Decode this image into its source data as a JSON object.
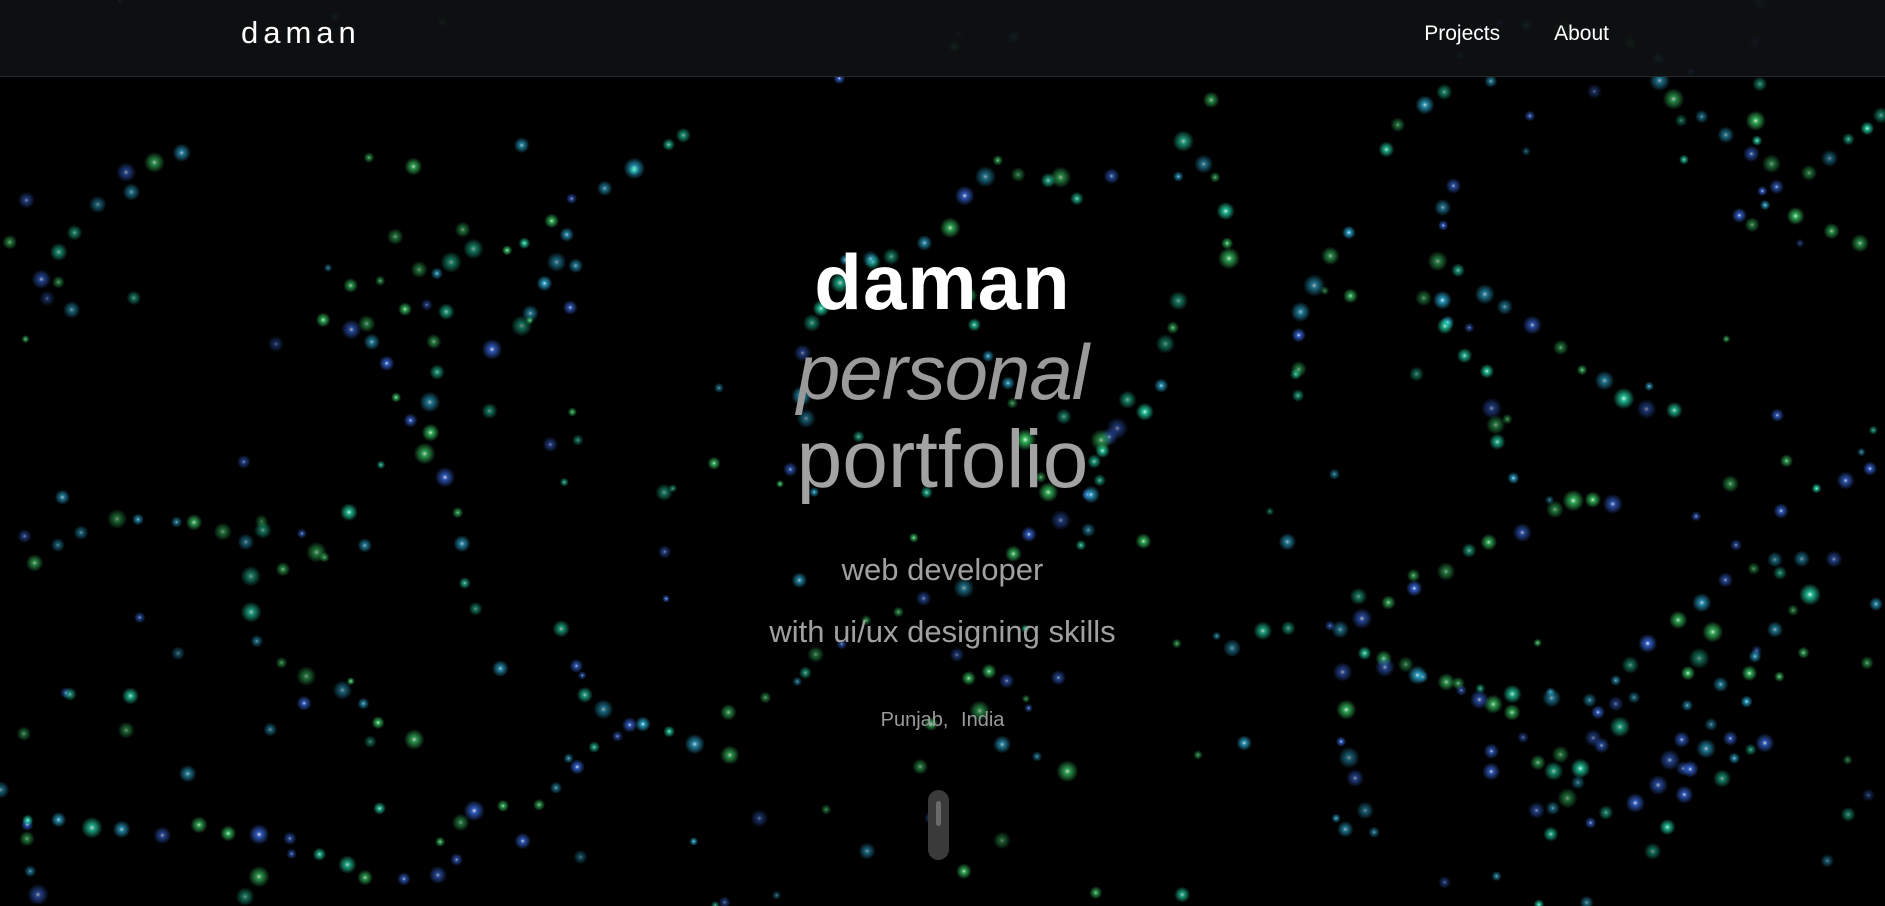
{
  "theme": {
    "background": "#000000",
    "particle_colors": [
      "#3cd36a",
      "#2fb5e0",
      "#3b6ee8",
      "#27e0b0"
    ]
  },
  "navbar": {
    "brand": "daman",
    "links": [
      {
        "label": "Projects"
      },
      {
        "label": "About"
      }
    ]
  },
  "hero": {
    "name": "daman",
    "word_personal": "personal",
    "word_portfolio": "portfolio",
    "role_line_1": "web developer",
    "role_line_2": "with ui/ux designing skills",
    "location_state": "Punjab,",
    "location_country": "India"
  },
  "scroll_indicator": {
    "icon": "scroll-mouse-icon"
  }
}
